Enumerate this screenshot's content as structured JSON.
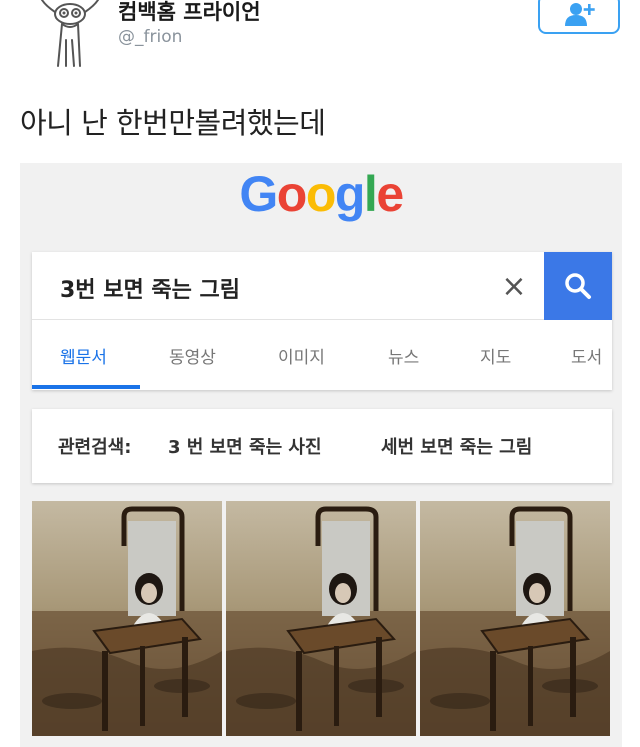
{
  "tweet": {
    "display_name": "컴백홈 프라이언",
    "handle": "@_frion",
    "text": "아니 난 한번만볼려했는데",
    "follow_icon": "add-user-icon",
    "accent_color": "#1da1f2"
  },
  "google": {
    "logo_letters": [
      "G",
      "o",
      "o",
      "g",
      "l",
      "e"
    ],
    "search_query": "3번 보면 죽는 그림",
    "clear_icon": "×",
    "search_icon": "search-icon",
    "accent_color": "#3b78e7",
    "tabs": [
      {
        "label": "웹문서",
        "active": true
      },
      {
        "label": "동영상",
        "active": false
      },
      {
        "label": "이미지",
        "active": false
      },
      {
        "label": "뉴스",
        "active": false
      },
      {
        "label": "지도",
        "active": false
      },
      {
        "label": "도서",
        "active": false
      }
    ],
    "related_label": "관련검색:",
    "related_links": [
      "3 번 보면 죽는 사진",
      "세번 보면 죽는 그림"
    ]
  }
}
